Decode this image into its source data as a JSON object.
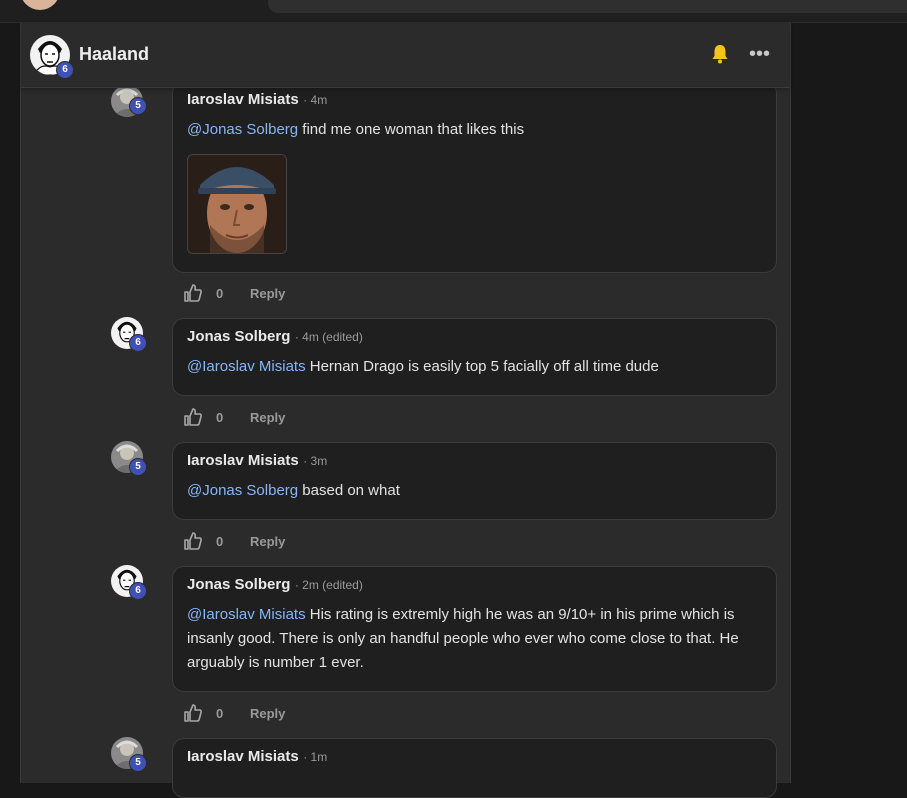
{
  "header": {
    "title": "Haaland",
    "badge": "6"
  },
  "comments": [
    {
      "author": "Iaroslav Misiats",
      "time": "· 4m",
      "mention": "@Jonas Solberg",
      "text": " find me one woman that likes this",
      "badge": "5",
      "likes": "0",
      "reply": "Reply"
    },
    {
      "author": "Jonas Solberg",
      "time": "· 4m (edited)",
      "mention": "@Iaroslav Misiats",
      "text": " Hernan Drago is easily top 5 facially off all time dude",
      "badge": "6",
      "likes": "0",
      "reply": "Reply"
    },
    {
      "author": "Iaroslav Misiats",
      "time": "· 3m",
      "mention": "@Jonas Solberg",
      "text": " based on what",
      "badge": "5",
      "likes": "0",
      "reply": "Reply"
    },
    {
      "author": "Jonas Solberg",
      "time": "· 2m (edited)",
      "mention": "@Iaroslav Misiats",
      "text": " His rating is extremly high he was an 9/10+ in his prime which is insanly good. There is only an handful people who ever who come close to that. He arguably is number 1 ever.",
      "badge": "6",
      "likes": "0",
      "reply": "Reply"
    },
    {
      "author": "Iaroslav Misiats",
      "time": "· 1m",
      "badge": "5"
    }
  ],
  "icons": {
    "bell": "bell-icon",
    "more": "more-options-icon",
    "like": "thumbs-up-icon"
  },
  "colors": {
    "mention": "#8ab4f8",
    "badge": "#3f51b5",
    "bell": "#f5c518"
  }
}
